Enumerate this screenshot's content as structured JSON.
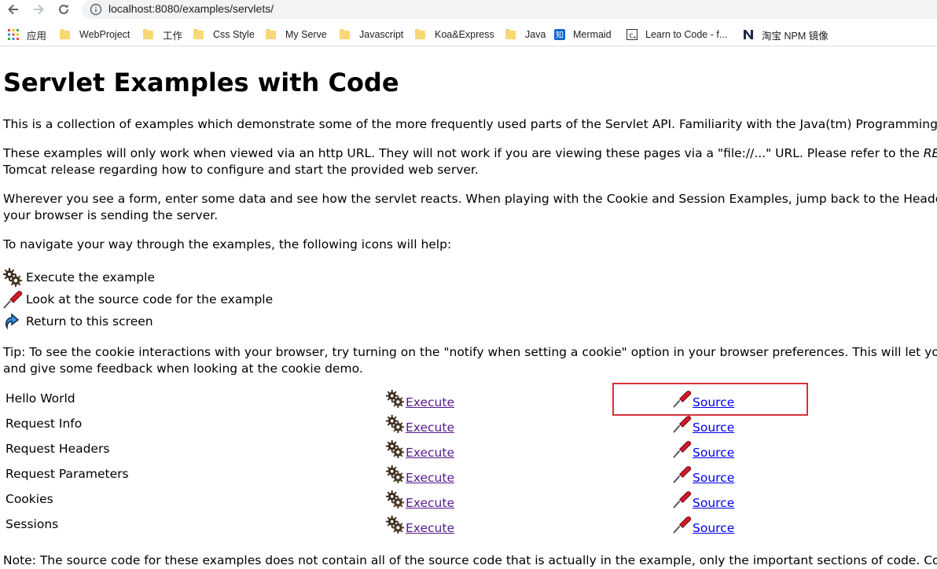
{
  "browser": {
    "url": "localhost:8080/examples/servlets/",
    "bookmarks": [
      {
        "label": "应用",
        "icon": "apps-grid-icon"
      },
      {
        "label": "WebProject",
        "icon": "folder-icon"
      },
      {
        "label": "工作",
        "icon": "folder-icon"
      },
      {
        "label": "Css Style",
        "icon": "folder-icon"
      },
      {
        "label": "My Serve",
        "icon": "folder-icon"
      },
      {
        "label": "Javascript",
        "icon": "folder-icon"
      },
      {
        "label": "Koa&Express",
        "icon": "folder-icon"
      },
      {
        "label": "Java",
        "icon": "folder-icon"
      },
      {
        "label": "Mermaid",
        "icon": "zhihu-icon"
      },
      {
        "label": "Learn to Code - f...",
        "icon": "freecodecamp-icon"
      },
      {
        "label": "淘宝 NPM 镜像",
        "icon": "npm-mirror-icon"
      }
    ]
  },
  "page": {
    "title": "Servlet Examples with Code",
    "intro": "This is a collection of examples which demonstrate some of the more frequently used parts of the Servlet API. Familiarity with the Java(tm) Programming La",
    "http_note_1_pre": "These examples will only work when viewed via an http URL. They will not work if you are viewing these pages via a \"file://...\" URL. Please refer to the ",
    "http_note_1_em": "READ",
    "http_note_2": "Tomcat release regarding how to configure and start the provided web server.",
    "form_note_1": "Wherever you see a form, enter some data and see how the servlet reacts. When playing with the Cookie and Session Examples, jump back to the Headers E",
    "form_note_2": "your browser is sending the server.",
    "navigate_note": "To navigate your way through the examples, the following icons will help:",
    "legend": {
      "execute": "Execute the example",
      "source": "Look at the source code for the example",
      "return": "Return to this screen"
    },
    "tip_1": "Tip: To see the cookie interactions with your browser, try turning on the \"notify when setting a cookie\" option in your browser preferences. This will let you s",
    "tip_2": "and give some feedback when looking at the cookie demo.",
    "footer_note": "Note: The source code for these examples does not contain all of the source code that is actually in the example, only the important sections of code. Code",
    "execute_label": "Execute",
    "source_label": "Source",
    "examples": [
      {
        "name": "Hello World"
      },
      {
        "name": "Request Info"
      },
      {
        "name": "Request Headers"
      },
      {
        "name": "Request Parameters"
      },
      {
        "name": "Cookies"
      },
      {
        "name": "Sessions"
      }
    ]
  },
  "colors": {
    "visited_link": "#551a8b",
    "link": "#0000ee",
    "highlight_box": "#d9303a"
  }
}
